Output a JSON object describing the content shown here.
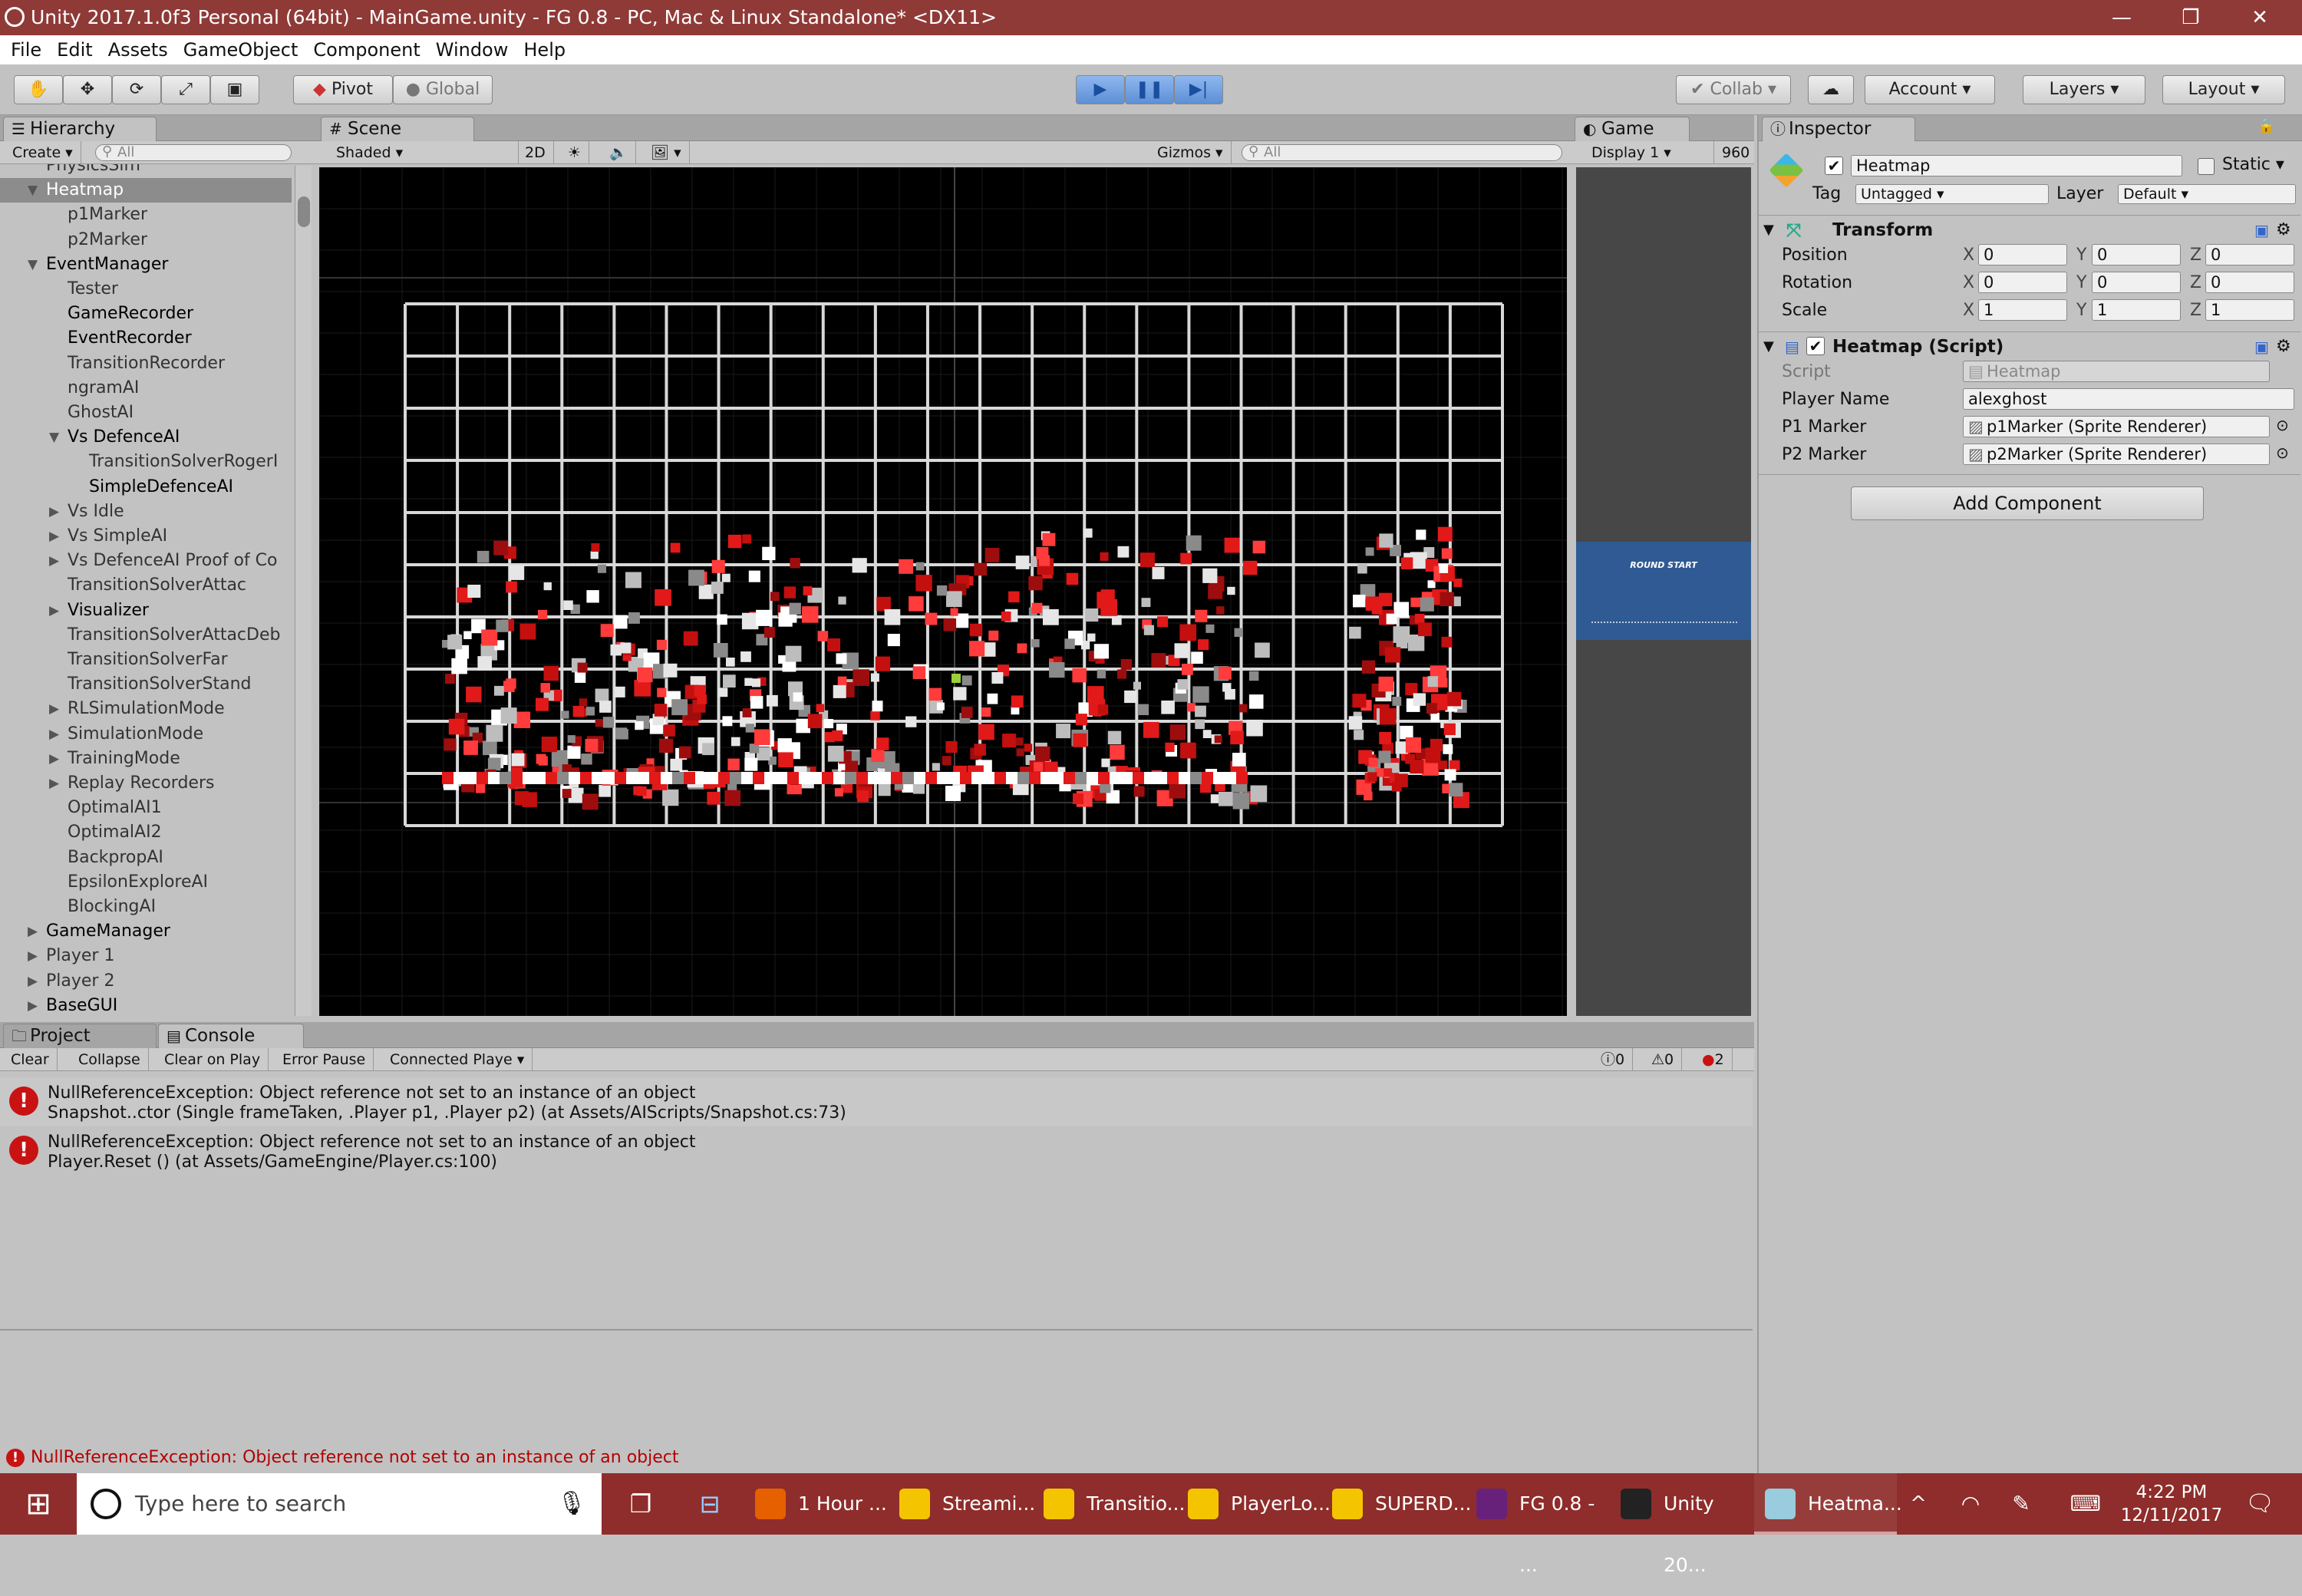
{
  "window": {
    "title": "Unity 2017.1.0f3 Personal (64bit) - MainGame.unity - FG 0.8 - PC, Mac & Linux Standalone* <DX11>",
    "min": "—",
    "max": "❐",
    "close": "✕"
  },
  "menu": [
    "File",
    "Edit",
    "Assets",
    "GameObject",
    "Component",
    "Window",
    "Help"
  ],
  "toolbar": {
    "pivot": "Pivot",
    "global": "Global",
    "collab": "Collab ▾",
    "account": "Account ▾",
    "layers": "Layers ▾",
    "layout": "Layout ▾"
  },
  "hierarchy": {
    "tab": "Hierarchy",
    "create": "Create ▾",
    "search_placeholder": "All",
    "items": [
      {
        "label": "PhysicsSim",
        "indent": 1
      },
      {
        "label": "Heatmap",
        "indent": 1,
        "arrow": "▼",
        "selected": true
      },
      {
        "label": "p1Marker",
        "indent": 2
      },
      {
        "label": "p2Marker",
        "indent": 2
      },
      {
        "label": "EventManager",
        "indent": 1,
        "arrow": "▼",
        "bold": true
      },
      {
        "label": "Tester",
        "indent": 2
      },
      {
        "label": "GameRecorder",
        "indent": 2,
        "bold": true
      },
      {
        "label": "EventRecorder",
        "indent": 2,
        "bold": true
      },
      {
        "label": "TransitionRecorder",
        "indent": 2
      },
      {
        "label": "ngramAI",
        "indent": 2
      },
      {
        "label": "GhostAI",
        "indent": 2
      },
      {
        "label": "Vs DefenceAI",
        "indent": 2,
        "arrow": "▼",
        "bold": true
      },
      {
        "label": "TransitionSolverRogerI",
        "indent": 3
      },
      {
        "label": "SimpleDefenceAI",
        "indent": 3,
        "bold": true
      },
      {
        "label": "Vs Idle",
        "indent": 2,
        "arrow": "▶"
      },
      {
        "label": "Vs SimpleAI",
        "indent": 2,
        "arrow": "▶"
      },
      {
        "label": "Vs DefenceAI Proof of Co",
        "indent": 2,
        "arrow": "▶"
      },
      {
        "label": "TransitionSolverAttac",
        "indent": 2
      },
      {
        "label": "Visualizer",
        "indent": 2,
        "arrow": "▶",
        "bold": true
      },
      {
        "label": "TransitionSolverAttacDeb",
        "indent": 2
      },
      {
        "label": "TransitionSolverFar",
        "indent": 2
      },
      {
        "label": "TransitionSolverStand",
        "indent": 2
      },
      {
        "label": "RLSimulationMode",
        "indent": 2,
        "arrow": "▶"
      },
      {
        "label": "SimulationMode",
        "indent": 2,
        "arrow": "▶"
      },
      {
        "label": "TrainingMode",
        "indent": 2,
        "arrow": "▶"
      },
      {
        "label": "Replay Recorders",
        "indent": 2,
        "arrow": "▶"
      },
      {
        "label": "OptimalAI1",
        "indent": 2
      },
      {
        "label": "OptimalAI2",
        "indent": 2
      },
      {
        "label": "BackpropAI",
        "indent": 2
      },
      {
        "label": "EpsilonExploreAI",
        "indent": 2
      },
      {
        "label": "BlockingAI",
        "indent": 2
      },
      {
        "label": "GameManager",
        "indent": 1,
        "arrow": "▶",
        "bold": true
      },
      {
        "label": "Player 1",
        "indent": 1,
        "arrow": "▶"
      },
      {
        "label": "Player 2",
        "indent": 1,
        "arrow": "▶"
      },
      {
        "label": "BaseGUI",
        "indent": 1,
        "arrow": "▶",
        "bold": true
      }
    ]
  },
  "scene": {
    "tab": "Scene",
    "shading": "Shaded ▾",
    "mode2d": "2D",
    "gizmos": "Gizmos ▾",
    "search_placeholder": "All"
  },
  "game": {
    "tab": "Game",
    "display": "Display 1 ▾",
    "resolution": "960",
    "overlay_text": "ROUND START"
  },
  "inspector": {
    "tab": "Inspector",
    "object_name": "Heatmap",
    "static_label": "Static ▾",
    "tag_label": "Tag",
    "tag_value": "Untagged ▾",
    "layer_label": "Layer",
    "layer_value": "Default ▾",
    "transform": {
      "title": "Transform",
      "rows": [
        {
          "label": "Position",
          "x": "0",
          "y": "0",
          "z": "0"
        },
        {
          "label": "Rotation",
          "x": "0",
          "y": "0",
          "z": "0"
        },
        {
          "label": "Scale",
          "x": "1",
          "y": "1",
          "z": "1"
        }
      ]
    },
    "script_comp": {
      "title": "Heatmap (Script)",
      "script_label": "Script",
      "script_value": "Heatmap",
      "player_label": "Player Name",
      "player_value": "alexghost",
      "p1_label": "P1 Marker",
      "p1_value": "p1Marker (Sprite Renderer)",
      "p2_label": "P2 Marker",
      "p2_value": "p2Marker (Sprite Renderer)"
    },
    "add_component": "Add Component"
  },
  "console": {
    "tab_project": "Project",
    "tab_console": "Console",
    "buttons": [
      "Clear",
      "Collapse",
      "Clear on Play",
      "Error Pause",
      "Connected Playe ▾"
    ],
    "counts": {
      "info": "0",
      "warn": "0",
      "error": "2"
    },
    "entries": [
      {
        "line1": "NullReferenceException: Object reference not set to an instance of an object",
        "line2": "Snapshot..ctor (Single frameTaken, .Player p1, .Player p2) (at Assets/AIScripts/Snapshot.cs:73)"
      },
      {
        "line1": "NullReferenceException: Object reference not set to an instance of an object",
        "line2": "Player.Reset () (at Assets/GameEngine/Player.cs:100)"
      }
    ],
    "status": "NullReferenceException: Object reference not set to an instance of an object"
  },
  "taskbar": {
    "search_placeholder": "Type here to search",
    "apps": [
      "1 Hour ...",
      "Streami...",
      "Transitio...",
      "PlayerLo...",
      "SUPERD...",
      "FG 0.8 - ...",
      "Unity 20...",
      "Heatma..."
    ],
    "time": "4:22 PM",
    "date": "12/11/2017"
  },
  "colors": {
    "titlebar": "#8f3a37",
    "taskbar": "#8e2d2b",
    "panel": "#c2c2c2",
    "play_blue": "#3b7bd6",
    "error_red": "#c91212",
    "heat_red": "#e11919"
  }
}
